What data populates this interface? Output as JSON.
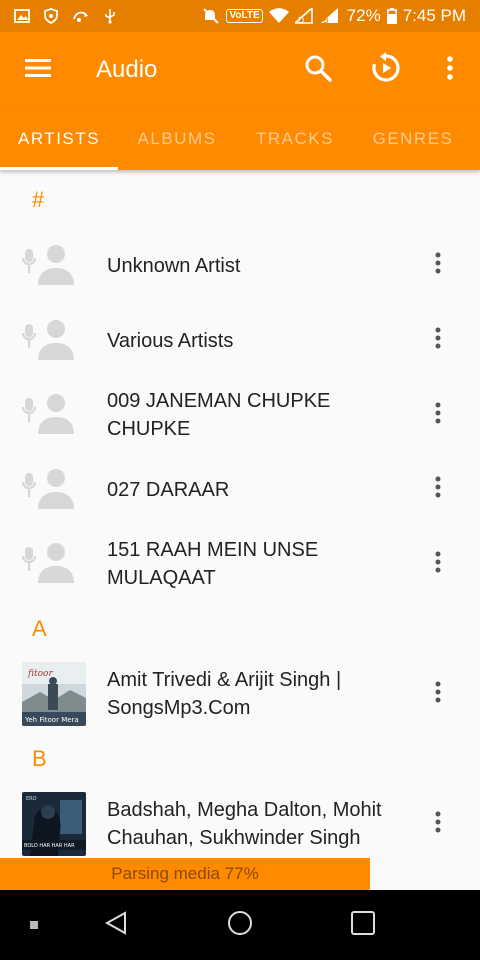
{
  "status_bar": {
    "volte_label": "VoLTE",
    "battery_percent": "72%",
    "time": "7:45 PM"
  },
  "app_bar": {
    "title": "Audio"
  },
  "tabs": [
    {
      "label": "ARTISTS",
      "active": true
    },
    {
      "label": "ALBUMS",
      "active": false
    },
    {
      "label": "TRACKS",
      "active": false
    },
    {
      "label": "GENRES",
      "active": false
    }
  ],
  "sections": [
    {
      "header": "#"
    },
    {
      "header": "A"
    },
    {
      "header": "B"
    }
  ],
  "artists": [
    {
      "name": "Unknown Artist"
    },
    {
      "name": "Various Artists"
    },
    {
      "name": "009 JANEMAN CHUPKE CHUPKE"
    },
    {
      "name": "027 DARAAR"
    },
    {
      "name": "151 RAAH MEIN UNSE MULAQAAT"
    },
    {
      "name": "Amit Trivedi & Arijit Singh | SongsMp3.Com",
      "thumb_caption": "Yeh Fitoor Mera"
    },
    {
      "name": "Badshah, Megha Dalton, Mohit Chauhan, Sukhwinder Singh",
      "thumb_caption": "BOLO HAR HAR HAR"
    }
  ],
  "toast": {
    "text": "Parsing media 77%"
  },
  "colors": {
    "primary": "#ff8a00",
    "status_bar": "#e67e00",
    "background": "#fafafa"
  },
  "icons": {
    "menu": "hamburger-icon",
    "search": "search-icon",
    "resume": "resume-playback-icon",
    "overflow": "more-vert-icon",
    "artist_placeholder": "artist-placeholder-icon"
  }
}
